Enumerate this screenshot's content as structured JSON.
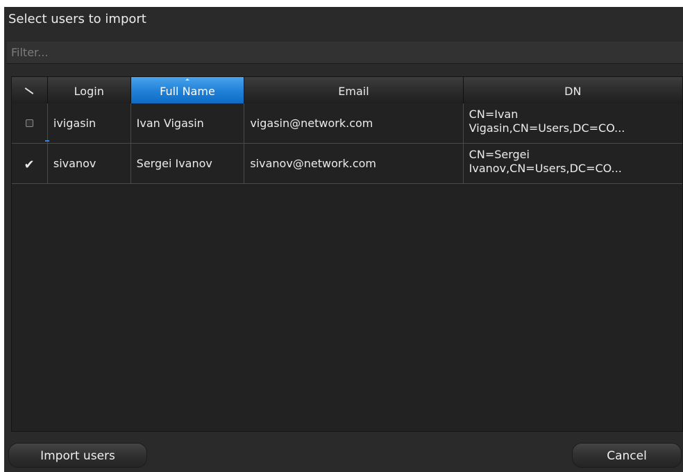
{
  "dialog": {
    "title": "Select users to import",
    "filter_placeholder": "Filter..."
  },
  "table": {
    "columns": [
      "",
      "Login",
      "Full Name",
      "Email",
      "DN"
    ],
    "sorted_column": "Full Name",
    "rows": [
      {
        "checked": false,
        "login": "ivigasin",
        "full_name": "Ivan Vigasin",
        "email": "vigasin@network.com",
        "dn_line1": "CN=Ivan",
        "dn_line2": "Vigasin,CN=Users,DC=CO..."
      },
      {
        "checked": true,
        "login": "sivanov",
        "full_name": "Sergei Ivanov",
        "email": "sivanov@network.com",
        "dn_line1": "CN=Sergei",
        "dn_line2": "Ivanov,CN=Users,DC=CO..."
      }
    ]
  },
  "buttons": {
    "import_label": "Import users",
    "cancel_label": "Cancel"
  },
  "colors": {
    "background": "#2a2a2a",
    "sorted_header": "#1f80d6",
    "text": "#ececec"
  },
  "icons": {
    "select_all": "select-all-icon",
    "checkbox_checked": "check-icon"
  }
}
